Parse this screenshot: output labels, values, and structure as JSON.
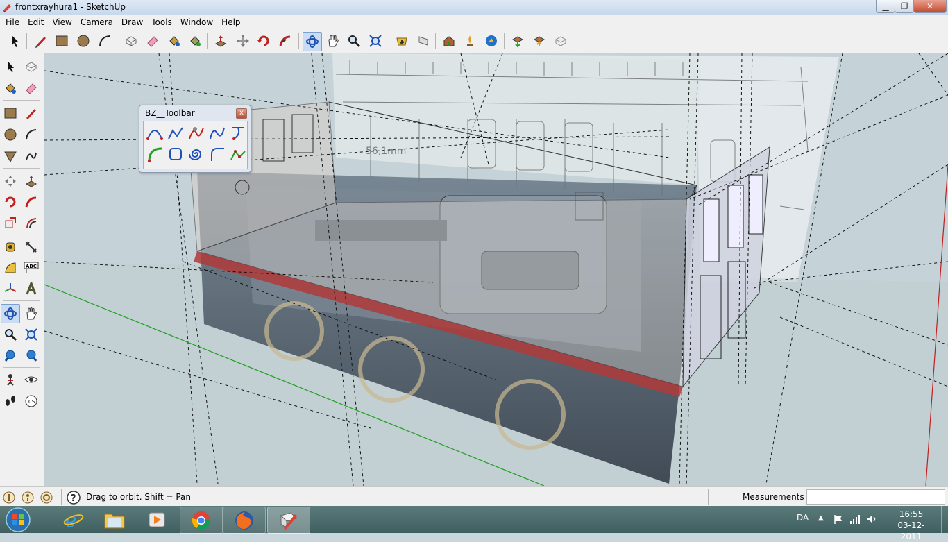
{
  "window": {
    "title": "frontxrayhura1 - SketchUp",
    "minimize": "▁",
    "maximize": "❐",
    "close": "✕"
  },
  "menubar": [
    "File",
    "Edit",
    "View",
    "Camera",
    "Draw",
    "Tools",
    "Window",
    "Help"
  ],
  "toolbar_icons": [
    "select-icon",
    "pencil-icon",
    "rectangle-icon",
    "circle-icon",
    "arc-icon",
    "make-component-icon",
    "eraser-icon",
    "paint-bucket-icon",
    "paint-bucket-2-icon",
    "push-pull-icon",
    "move-icon",
    "rotate-icon",
    "follow-me-icon",
    "orbit-icon",
    "pan-icon",
    "zoom-icon",
    "zoom-extents-icon",
    "previous-view-icon",
    "next-view-icon",
    "3d-warehouse-icon",
    "get-models-icon",
    "share-model-icon",
    "google-earth-icon",
    "get-current-view-icon",
    "toggle-terrain-icon",
    "place-model-icon"
  ],
  "left_icons": [
    "select-icon",
    "make-component-icon",
    "paint-bucket-icon",
    "eraser-icon",
    "rectangle-icon",
    "line-icon",
    "circle-icon",
    "arc-icon",
    "polygon-icon",
    "freehand-icon",
    "move-icon",
    "push-pull-icon",
    "rotate-icon",
    "follow-me-icon",
    "scale-icon",
    "offset-icon",
    "tape-measure-icon",
    "dimension-icon",
    "protractor-icon",
    "text-icon",
    "axes-icon",
    "3d-text-icon",
    "orbit-icon",
    "pan-icon",
    "zoom-icon",
    "zoom-window-icon",
    "zoom-extents-icon",
    "previous-icon",
    "position-camera-icon",
    "look-around-icon",
    "walk-icon",
    "section-plane-icon"
  ],
  "viewport": {
    "dimension_label": "56,1mm"
  },
  "bz_toolbar": {
    "title": "BZ__Toolbar",
    "close": "x",
    "icons": [
      "bezier-curve-icon",
      "polyline-curve-icon",
      "f-spline-icon",
      "b-spline-icon",
      "cubic-bezier-icon",
      "arc-segment-icon",
      "rectangle-curve-icon",
      "spiral-icon",
      "fillet-icon",
      "divider-icon"
    ]
  },
  "statusbar": {
    "status": "Drag to orbit.  Shift = Pan",
    "measurements_label": "Measurements",
    "measurements_value": ""
  },
  "taskbar": {
    "apps": [
      "internet-explorer-icon",
      "file-explorer-icon",
      "media-player-icon",
      "chrome-icon",
      "firefox-icon",
      "sketchup-icon"
    ],
    "lang": "DA",
    "time": "16:55",
    "date": "03-12-2011"
  },
  "colors": {
    "sky": "#c5d2d7",
    "green_axis": "#20a020",
    "red_axis": "#c02020",
    "taskbar": "#4f6f70"
  }
}
